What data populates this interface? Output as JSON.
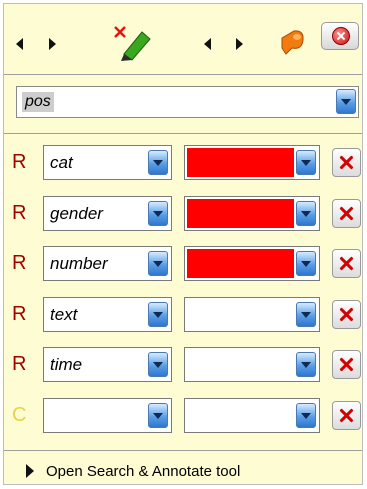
{
  "toolbar": {
    "eraser_icon": "eraser-pen-icon",
    "annotate_icon": "speaker-flag-icon",
    "close_icon": "close-circle-icon"
  },
  "pos_selector": {
    "value": "pos"
  },
  "rows": [
    {
      "label": "R",
      "label_color": "#a30000",
      "feature": "cat",
      "color_value": "#ff0000"
    },
    {
      "label": "R",
      "label_color": "#a30000",
      "feature": "gender",
      "color_value": "#ff0000"
    },
    {
      "label": "R",
      "label_color": "#a30000",
      "feature": "number",
      "color_value": "#ff0000"
    },
    {
      "label": "R",
      "label_color": "#a30000",
      "feature": "text",
      "color_value": ""
    },
    {
      "label": "R",
      "label_color": "#a30000",
      "feature": "time",
      "color_value": ""
    },
    {
      "label": "C",
      "label_color": "#e6d44a",
      "feature": "",
      "color_value": ""
    }
  ],
  "footer": {
    "label": "Open Search & Annotate tool"
  }
}
